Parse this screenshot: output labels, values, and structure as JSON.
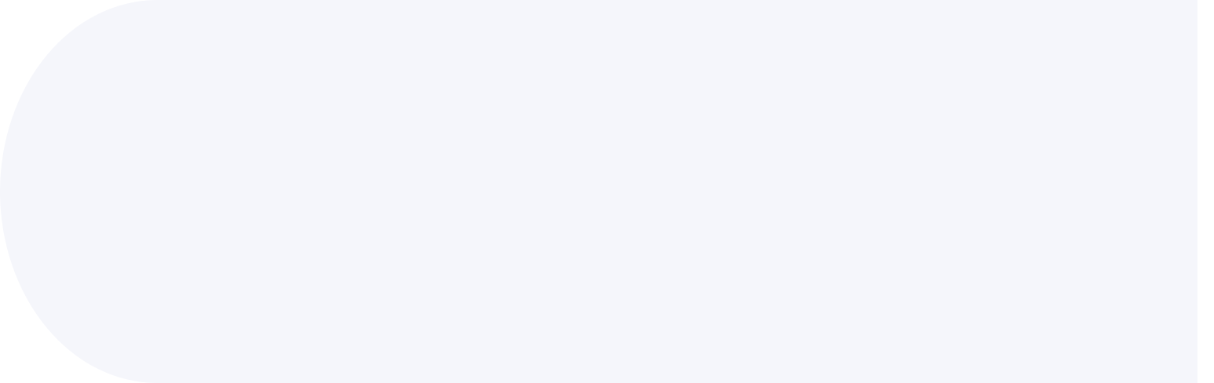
{
  "panel": {
    "background_color": "#F5F6FB",
    "page_background_color": "#FFFFFF",
    "content_text": ""
  }
}
